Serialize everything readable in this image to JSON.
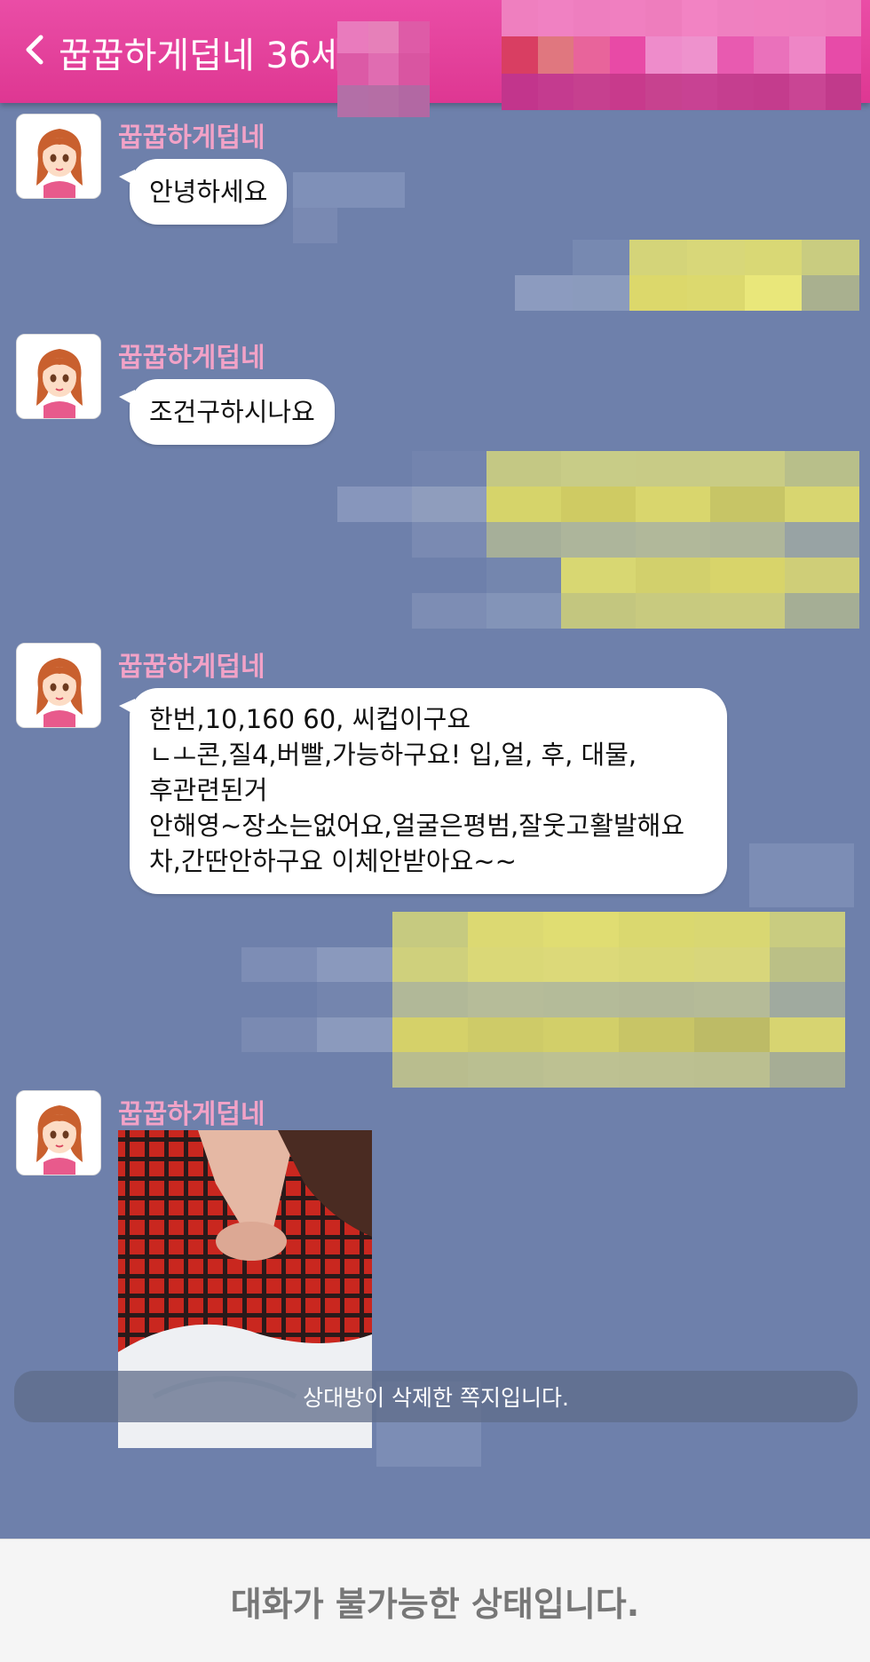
{
  "header": {
    "title": "꿉꿉하게덥네 36세",
    "back_icon": "chevron-left-icon",
    "background": "#e63f9b"
  },
  "messages": [
    {
      "sender": "꿉꿉하게덥네",
      "lines": [
        "안녕하세요"
      ]
    },
    {
      "sender": "꿉꿉하게덥네",
      "lines": [
        "조건구하시나요"
      ]
    },
    {
      "sender": "꿉꿉하게덥네",
      "lines": [
        "한번,10,160 60, 씨컵이구요",
        "ㄴㅗ콘,질4,버빨,가능하구요! 입,얼, 후, 대물,",
        "후관련된거",
        "안해영~장소는없어요,얼굴은평범,잘웃고활발해요",
        "차,간딴안하구요 이체안받아요~~"
      ]
    },
    {
      "sender": "꿉꿉하게덥네",
      "type": "image"
    }
  ],
  "notice": "상대방이 삭제한 쪽지입니다.",
  "footer": {
    "status": "대화가 불가능한 상태입니다."
  },
  "colors": {
    "chat_background": "#6e80ab",
    "sender_name": "#f2a2c7",
    "bubble": "#ffffff",
    "own_bubble_redacted": "#d6d26a"
  }
}
